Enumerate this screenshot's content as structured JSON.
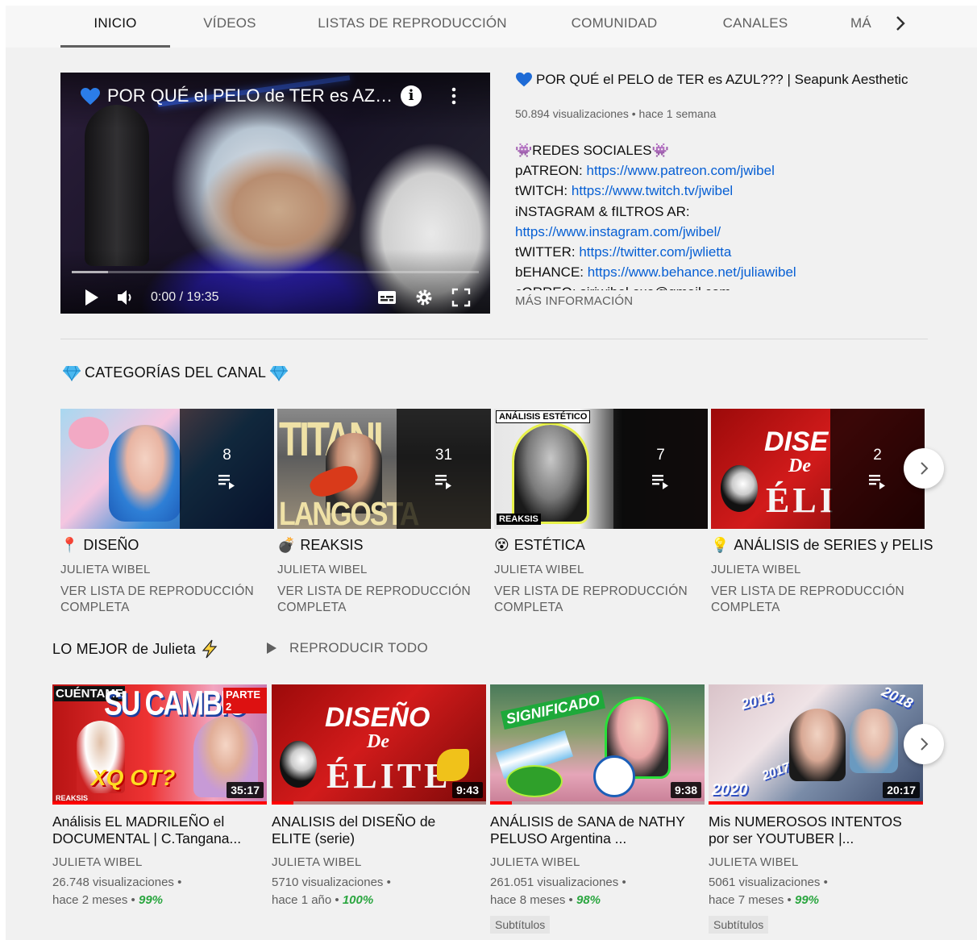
{
  "tabs": [
    {
      "label": "INICIO",
      "active": true
    },
    {
      "label": "VÍDEOS",
      "active": false
    },
    {
      "label": "LISTAS DE REPRODUCCIÓN",
      "active": false
    },
    {
      "label": "COMUNIDAD",
      "active": false
    },
    {
      "label": "CANALES",
      "active": false
    },
    {
      "label": "MÁ",
      "active": false
    }
  ],
  "featured": {
    "player_title": "POR QUÉ el PELO de TER es AZUL???",
    "time": "0:00 / 19:35",
    "progress_fraction": 0.09,
    "title": "POR QUÉ el PELO de TER es AZUL??? | Seapunk Aesthetic",
    "meta": "50.894 visualizaciones • hace 1 semana",
    "desc": {
      "line1": "REDES SOCIALES",
      "patreon_label": "pATREON: ",
      "patreon_url": "https://www.patreon.com/jwibel",
      "twitch_label": "tWITCH: ",
      "twitch_url": "https://www.twitch.tv/jwibel",
      "instagram_label": "iNSTAGRAM & fILTROS AR:",
      "instagram_url": "https://www.instagram.com/jwibel/",
      "twitter_label": "tWITTER: ",
      "twitter_url": "https://twitter.com/jwlietta",
      "behance_label": "bEHANCE: ",
      "behance_url": "https://www.behance.net/juliawibel",
      "correo": "cORREO: siriwibel.exe@gmail.com"
    },
    "more_label": "MÁS INFORMACIÓN"
  },
  "categories": {
    "title": "CATEGORÍAS DEL CANAL",
    "view_full": "VER LISTA DE REPRODUCCIÓN COMPLETA",
    "playlists": [
      {
        "emoji": "📍",
        "title": "DISEÑO",
        "count": "8",
        "channel": "JULIETA WIBEL"
      },
      {
        "emoji": "💣",
        "title": "REAKSIS",
        "count": "31",
        "channel": "JULIETA WIBEL",
        "thumb_text_top": "TITANI",
        "thumb_text_bottom": "LANGOSTA"
      },
      {
        "emoji": "😵",
        "title": "ESTÉTICA",
        "count": "7",
        "channel": "JULIETA WIBEL",
        "thumb_text_top": "ANÁLISIS ESTÉTICO",
        "thumb_text_bottom": "REAKSIS"
      },
      {
        "emoji": "💡",
        "title": "ANÁLISIS de SERIES y PELIS",
        "count": "2",
        "channel": "JULIETA WIBEL",
        "thumb_text_top": "DISE",
        "thumb_text_mid": "De",
        "thumb_text_bottom": "ÉLI"
      }
    ]
  },
  "best": {
    "title": "LO MEJOR de Julieta",
    "play_all": "REPRODUCIR TODO",
    "subtitles": "Subtítulos",
    "videos": [
      {
        "title": "Análisis EL MADRILEÑO el DOCUMENTAL | C.Tangana...",
        "duration": "35:17",
        "channel": "JULIETA WIBEL",
        "views": "26.748 visualizaciones",
        "age": "hace 2 meses",
        "pct": "99%",
        "watched": 1.0,
        "subtitles": false,
        "thumb_a": "CUÉNTAME",
        "thumb_b": "SU CAMBIO",
        "thumb_c": "PARTE 2",
        "thumb_d": "XQ OT?",
        "thumb_e": "REAKSIS"
      },
      {
        "title": "ANALISIS del DISEÑO de ELITE (serie)",
        "duration": "9:43",
        "channel": "JULIETA WIBEL",
        "views": "5710 visualizaciones",
        "age": "hace 1 año",
        "pct": "100%",
        "watched": 0.1,
        "subtitles": false,
        "thumb_a": "DISEÑO",
        "thumb_b": "De",
        "thumb_c": "ÉLITE"
      },
      {
        "title": "ANÁLISIS de SANA de NATHY PELUSO Argentina ...",
        "duration": "9:38",
        "channel": "JULIETA WIBEL",
        "views": "261.051 visualizaciones",
        "age": "hace 8 meses",
        "pct": "98%",
        "watched": 0.1,
        "subtitles": true,
        "thumb_a": "SIGNIFICADO"
      },
      {
        "title": "Mis NUMEROSOS INTENTOS por ser YOUTUBER |...",
        "duration": "20:17",
        "channel": "JULIETA WIBEL",
        "views": "5061 visualizaciones",
        "age": "hace 7 meses",
        "pct": "99%",
        "watched": 1.0,
        "subtitles": true,
        "thumb_a": "2016",
        "thumb_b": "2018",
        "thumb_c": "2017",
        "thumb_d": "2020"
      }
    ]
  },
  "colors": {
    "accent_red": "#ff0000",
    "link_blue": "#065fd4",
    "pct_green": "#2ba640",
    "heart_blue": "#1e6bd6"
  }
}
